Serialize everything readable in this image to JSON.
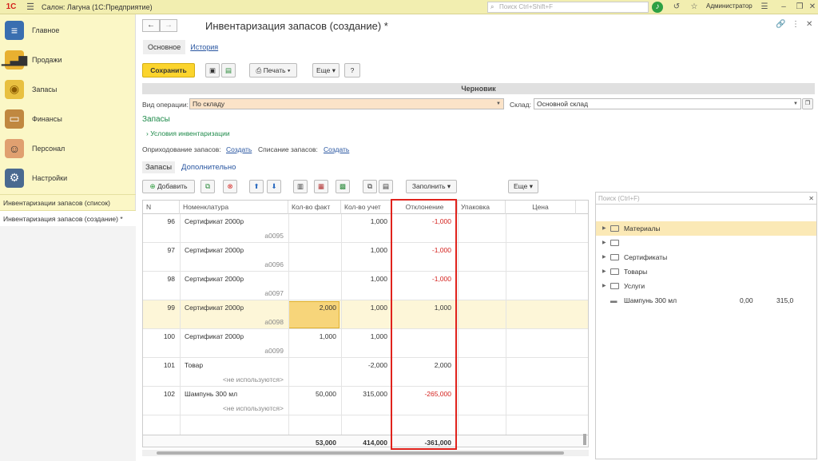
{
  "topbar": {
    "logo": "1С",
    "app_title": "Салон: Лагуна  (1С:Предприятие)",
    "search_placeholder": "Поиск Ctrl+Shift+F",
    "user": "Администратор"
  },
  "sidebar": {
    "items": [
      {
        "label": "Главное",
        "icon": "list-icon"
      },
      {
        "label": "Продажи",
        "icon": "chart-icon"
      },
      {
        "label": "Запасы",
        "icon": "coins-icon"
      },
      {
        "label": "Финансы",
        "icon": "wallet-icon"
      },
      {
        "label": "Персонал",
        "icon": "people-icon"
      },
      {
        "label": "Настройки",
        "icon": "gear-icon"
      }
    ],
    "open_windows": [
      "Инвентаризации запасов (список)",
      "Инвентаризация запасов (создание) *"
    ]
  },
  "form": {
    "title": "Инвентаризация запасов (создание) *",
    "tabs": [
      "Основное",
      "История"
    ],
    "toolbar": {
      "save": "Сохранить",
      "print": "Печать",
      "more": "Еще",
      "help": "?"
    },
    "status": "Черновик",
    "operation_label": "Вид операции:",
    "operation_value": "По складу",
    "warehouse_label": "Склад:",
    "warehouse_value": "Основной склад",
    "section_title": "Запасы",
    "conditions_link": "Условия инвентаризации",
    "receipt_label": "Оприходование запасов:",
    "receipt_link": "Создать",
    "writeoff_label": "Списание запасов:",
    "writeoff_link": "Создать",
    "subtabs": [
      "Запасы",
      "Дополнительно"
    ],
    "table_toolbar": {
      "add": "Добавить",
      "fill": "Заполнить",
      "more": "Еще"
    }
  },
  "table": {
    "columns": [
      "N",
      "Номенклатура",
      "Кол-во факт",
      "Кол-во учет",
      "Отклонение",
      "Упаковка",
      "Цена"
    ],
    "rows": [
      {
        "n": "96",
        "name": "Сертификат 2000р",
        "sub": "а0095",
        "fact": "",
        "account": "1,000",
        "diff": "-1,000",
        "neg": true,
        "hl": false
      },
      {
        "n": "97",
        "name": "Сертификат 2000р",
        "sub": "а0096",
        "fact": "",
        "account": "1,000",
        "diff": "-1,000",
        "neg": true,
        "hl": false
      },
      {
        "n": "98",
        "name": "Сертификат 2000р",
        "sub": "а0097",
        "fact": "",
        "account": "1,000",
        "diff": "-1,000",
        "neg": true,
        "hl": false
      },
      {
        "n": "99",
        "name": "Сертификат 2000р",
        "sub": "а0098",
        "fact": "2,000",
        "account": "1,000",
        "diff": "1,000",
        "neg": false,
        "hl": true
      },
      {
        "n": "100",
        "name": "Сертификат 2000р",
        "sub": "а0099",
        "fact": "1,000",
        "account": "1,000",
        "diff": "",
        "neg": false,
        "hl": false
      },
      {
        "n": "101",
        "name": "Товар",
        "sub": "<не используются>",
        "fact": "",
        "account": "-2,000",
        "diff": "2,000",
        "neg": false,
        "hl": false
      },
      {
        "n": "102",
        "name": "Шампунь 300 мл",
        "sub": "<не используются>",
        "fact": "50,000",
        "account": "315,000",
        "diff": "-265,000",
        "neg": true,
        "hl": false
      }
    ],
    "totals": {
      "fact": "53,000",
      "account": "414,000",
      "diff": "-361,000"
    }
  },
  "tree": {
    "search_placeholder": "Поиск (Ctrl+F)",
    "items": [
      {
        "label": "Материалы",
        "folder": true,
        "selected": true
      },
      {
        "label": "",
        "folder": true,
        "selected": false
      },
      {
        "label": "Сертификаты",
        "folder": true,
        "selected": false
      },
      {
        "label": "Товары",
        "folder": true,
        "selected": false
      },
      {
        "label": "Услуги",
        "folder": true,
        "selected": false
      }
    ],
    "product": {
      "label": "Шампунь 300 мл",
      "qty": "0,00",
      "price": "315,0"
    }
  }
}
